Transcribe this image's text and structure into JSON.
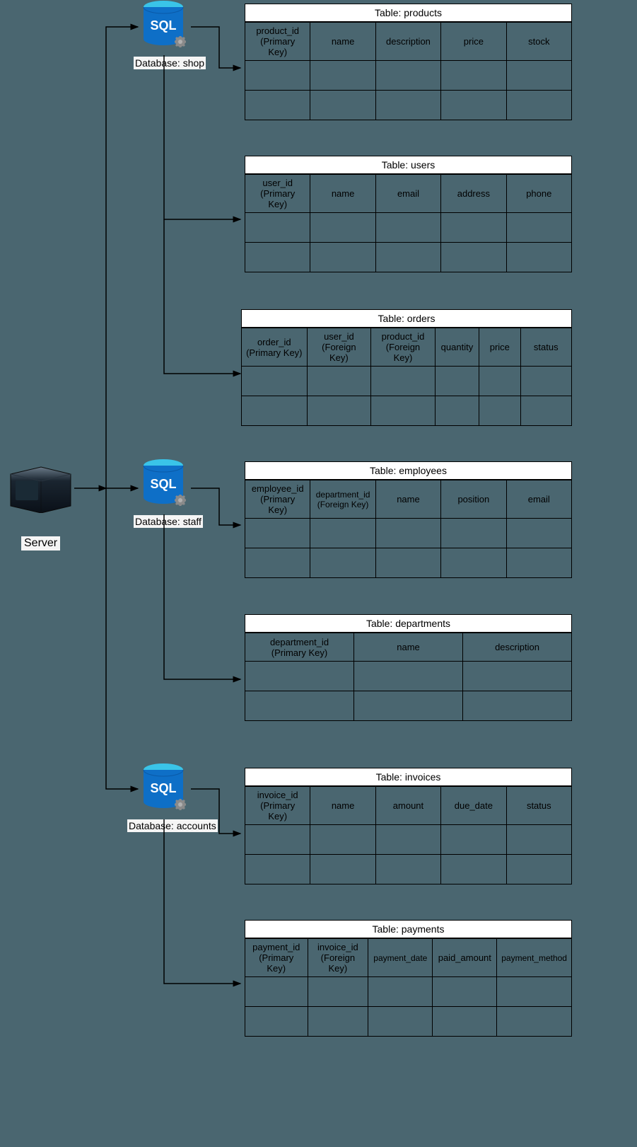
{
  "server": {
    "label": "Server"
  },
  "databases": {
    "shop": {
      "label": "Database: shop"
    },
    "staff": {
      "label": "Database: staff"
    },
    "accounts": {
      "label": "Database: accounts"
    }
  },
  "tables": {
    "products": {
      "title": "Table: products",
      "cols": {
        "c0a": "product_id",
        "c0b": "(Primary Key)",
        "c1": "name",
        "c2": "description",
        "c3": "price",
        "c4": "stock"
      }
    },
    "users": {
      "title": "Table: users",
      "cols": {
        "c0a": "user_id",
        "c0b": "(Primary Key)",
        "c1": "name",
        "c2": "email",
        "c3": "address",
        "c4": "phone"
      }
    },
    "orders": {
      "title": "Table: orders",
      "cols": {
        "c0a": "order_id",
        "c0b": "(Primary Key)",
        "c1a": "user_id",
        "c1b": "(Foreign Key)",
        "c2a": "product_id",
        "c2b": "(Foreign Key)",
        "c3": "quantity",
        "c4": "price",
        "c5": "status"
      }
    },
    "employees": {
      "title": "Table: employees",
      "cols": {
        "c0a": "employee_id",
        "c0b": "(Primary Key)",
        "c1a": "department_id",
        "c1b": "(Foreign Key)",
        "c2": "name",
        "c3": "position",
        "c4": "email"
      }
    },
    "departments": {
      "title": "Table: departments",
      "cols": {
        "c0a": "department_id",
        "c0b": "(Primary Key)",
        "c1": "name",
        "c2": "description"
      }
    },
    "invoices": {
      "title": "Table: invoices",
      "cols": {
        "c0a": "invoice_id",
        "c0b": "(Primary Key)",
        "c1": "name",
        "c2": "amount",
        "c3": "due_date",
        "c4": "status"
      }
    },
    "payments": {
      "title": "Table: payments",
      "cols": {
        "c0a": "payment_id",
        "c0b": "(Primary Key)",
        "c1a": "invoice_id",
        "c1b": "(Foreign Key)",
        "c2": "payment_date",
        "c3": "paid_amount",
        "c4": "payment_method"
      }
    }
  }
}
